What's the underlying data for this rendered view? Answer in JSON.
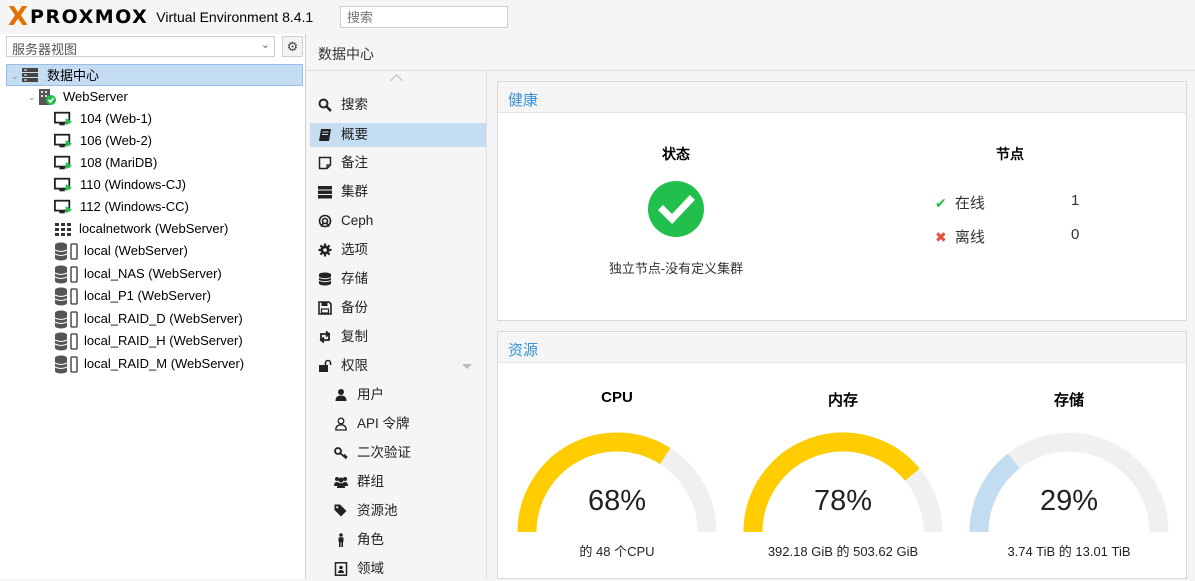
{
  "app": {
    "logo_text": "PROXMOX",
    "title": "Virtual Environment 8.4.1",
    "search_placeholder": "搜索"
  },
  "tree": {
    "view_selector": "服务器视图",
    "datacenter": "数据中心",
    "server": "WebServer",
    "vms": [
      "104 (Web-1)",
      "106 (Web-2)",
      "108 (MariDB)",
      "110 (Windows-CJ)",
      "112 (Windows-CC)"
    ],
    "network": "localnetwork (WebServer)",
    "storages": [
      "local (WebServer)",
      "local_NAS (WebServer)",
      "local_P1 (WebServer)",
      "local_RAID_D (WebServer)",
      "local_RAID_H (WebServer)",
      "local_RAID_M (WebServer)"
    ]
  },
  "header": {
    "title": "数据中心"
  },
  "nav": {
    "items": [
      {
        "label": "搜索",
        "icon": "search-icon"
      },
      {
        "label": "概要",
        "icon": "book-icon"
      },
      {
        "label": "备注",
        "icon": "note-icon"
      },
      {
        "label": "集群",
        "icon": "server-icon"
      },
      {
        "label": "Ceph",
        "icon": "ceph-icon"
      },
      {
        "label": "选项",
        "icon": "gear-icon"
      },
      {
        "label": "存储",
        "icon": "database-icon"
      },
      {
        "label": "备份",
        "icon": "floppy-icon"
      },
      {
        "label": "复制",
        "icon": "retweet-icon"
      },
      {
        "label": "权限",
        "icon": "unlock-icon"
      }
    ],
    "sub_items": [
      {
        "label": "用户",
        "icon": "user-icon"
      },
      {
        "label": "API 令牌",
        "icon": "user-outline-icon"
      },
      {
        "label": "二次验证",
        "icon": "key-icon"
      },
      {
        "label": "群组",
        "icon": "users-icon"
      },
      {
        "label": "资源池",
        "icon": "tags-icon"
      },
      {
        "label": "角色",
        "icon": "male-icon"
      },
      {
        "label": "领域",
        "icon": "address-book-icon"
      }
    ],
    "selected_index": 1
  },
  "health": {
    "title": "健康",
    "status_title": "状态",
    "status_text": "独立节点-没有定义集群",
    "nodes_title": "节点",
    "online_label": "在线",
    "online_count": "1",
    "offline_label": "离线",
    "offline_count": "0",
    "colors": {
      "ok": "#21bf4b",
      "error": "#e74c3c"
    }
  },
  "resources": {
    "title": "资源",
    "gauges": [
      {
        "title": "CPU",
        "percent_text": "68%",
        "fraction": 0.68,
        "sub": "的 48 个CPU",
        "color": "#ffcc00"
      },
      {
        "title": "内存",
        "percent_text": "78%",
        "fraction": 0.78,
        "sub": "392.18 GiB 的 503.62 GiB",
        "color": "#ffcc00"
      },
      {
        "title": "存储",
        "percent_text": "29%",
        "fraction": 0.29,
        "sub": "3.74 TiB 的 13.01 TiB",
        "color": "#c2ddf2"
      }
    ],
    "track_color": "#f0f0f0"
  }
}
